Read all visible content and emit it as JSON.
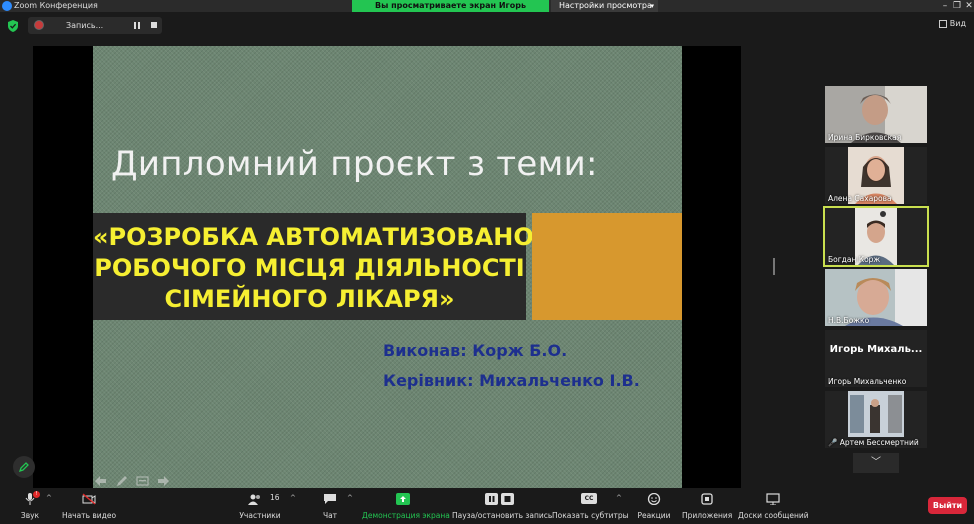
{
  "window": {
    "title": "Zoom Конференция",
    "share_banner": "Вы просматриваете экран Игорь Михальченко",
    "view_options": "Настройки просмотра"
  },
  "recording": {
    "label": "Запись..."
  },
  "view_button": "Вид",
  "slide": {
    "heading": "Дипломний проєкт з теми:",
    "title_lines": [
      "«РОЗРОБКА АВТОМАТИЗОВАНОГО",
      "РОБОЧОГО МІСЦЯ ДІЯЛЬНОСТІ",
      "СІМЕЙНОГО ЛІКАРЯ»"
    ],
    "performed_by": "Виконав: Корж Б.О.",
    "supervisor": "Керівник: Михальченко І.В."
  },
  "participants_panel": [
    {
      "name": "Ирина Бирковская"
    },
    {
      "name": "Алена Сахарова"
    },
    {
      "name": "Богдан Корж",
      "active": true
    },
    {
      "name": "Н.В.Божко"
    },
    {
      "name": "Игорь Михальченко",
      "big_name": "Игорь  Михаль..."
    },
    {
      "name": "Артем Бессмертний",
      "muted": true
    }
  ],
  "toolbar": {
    "audio": "Звук",
    "video": "Начать видео",
    "participants": "Участники",
    "participants_count": "16",
    "chat": "Чат",
    "share": "Демонстрация экрана",
    "pause_record": "Пауза/остановить запись",
    "captions": "Показать субтитры",
    "captions_icon_text": "CC",
    "reactions": "Реакции",
    "apps": "Приложения",
    "whiteboards": "Доски сообщений",
    "leave": "Выйти"
  },
  "colors": {
    "share_banner": "#23c552",
    "active_speaker": "#c9df4f",
    "slide_title_text": "#f6ef32",
    "slide_accent": "#d7982e",
    "credit_text": "#1d2f8e",
    "leave_button": "#d8273a"
  }
}
